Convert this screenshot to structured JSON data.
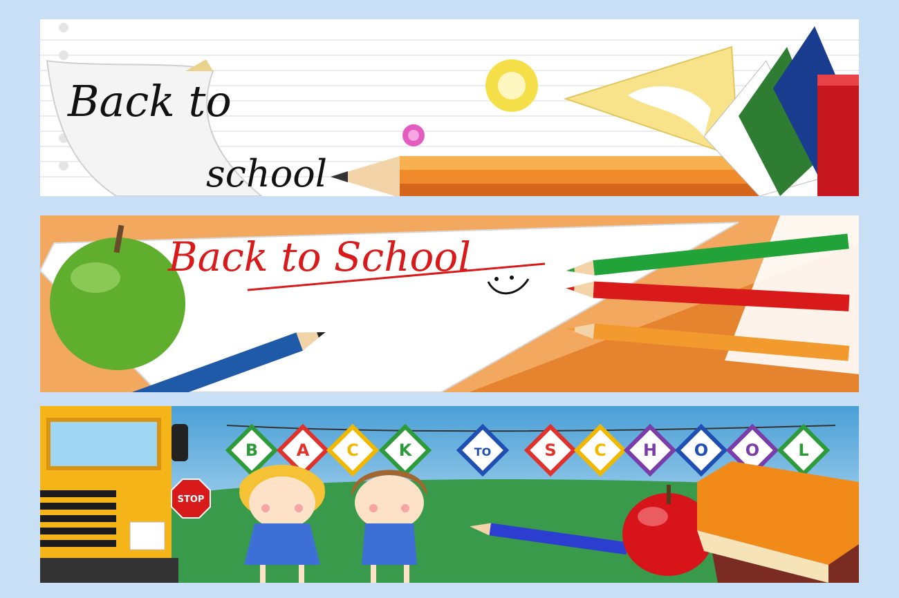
{
  "banners": [
    {
      "id": "b1",
      "line1": "Back to",
      "line2": "school"
    },
    {
      "id": "b2",
      "text": "Back to School"
    },
    {
      "id": "b3",
      "flags": [
        {
          "letter": "B",
          "color": "#2e9b3b"
        },
        {
          "letter": "A",
          "color": "#e0312b"
        },
        {
          "letter": "C",
          "color": "#f2b800"
        },
        {
          "letter": "K",
          "color": "#2e9b3b"
        },
        {
          "letter": "TO",
          "color": "#1f4fb3"
        },
        {
          "letter": "S",
          "color": "#e0312b"
        },
        {
          "letter": "C",
          "color": "#f2b800"
        },
        {
          "letter": "H",
          "color": "#7a3ca8"
        },
        {
          "letter": "O",
          "color": "#1f4fb3"
        },
        {
          "letter": "O",
          "color": "#7a3ca8"
        },
        {
          "letter": "L",
          "color": "#2e9b3b"
        }
      ],
      "stop_sign": "STOP"
    }
  ],
  "colors": {
    "page_bg": "#c8dff5",
    "apple_green": "#5fae2e",
    "apple_red": "#d6141a",
    "bus_yellow": "#f5b418",
    "grass": "#3a9a4c",
    "sky": "#8fc7ea"
  }
}
